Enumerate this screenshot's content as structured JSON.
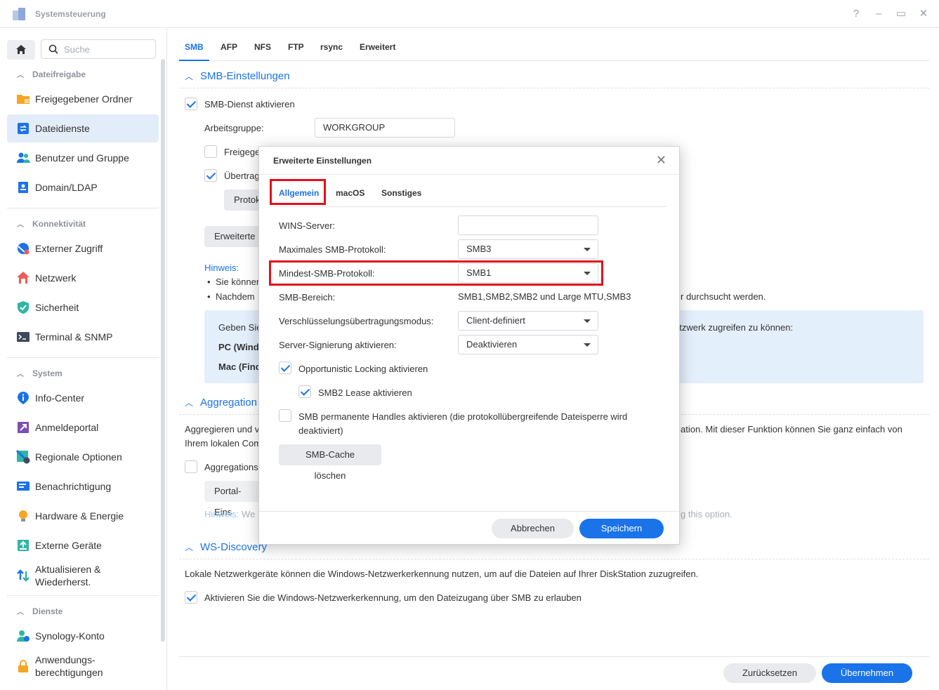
{
  "window": {
    "title": "Systemsteuerung",
    "controls": [
      "?",
      "–",
      "▭",
      "✕"
    ]
  },
  "sidebar": {
    "search_placeholder": "Suche",
    "sections": {
      "dateifreigabe": "Dateifreigabe",
      "konnektivitaet": "Konnektivität",
      "system": "System",
      "dienste": "Dienste"
    },
    "items": {
      "freigegebener_ordner": "Freigegebener Ordner",
      "dateidienste": "Dateidienste",
      "benutzer_gruppe": "Benutzer und Gruppe",
      "domain_ldap": "Domain/LDAP",
      "externer_zugriff": "Externer Zugriff",
      "netzwerk": "Netzwerk",
      "sicherheit": "Sicherheit",
      "terminal_snmp": "Terminal & SNMP",
      "info_center": "Info-Center",
      "anmeldeportal": "Anmeldeportal",
      "regionale_optionen": "Regionale Optionen",
      "benachrichtigung": "Benachrichtigung",
      "hardware_energie": "Hardware & Energie",
      "externe_geraete": "Externe Geräte",
      "aktualisieren_1": "Aktualisieren &",
      "aktualisieren_2": "Wiederherst.",
      "synology_konto": "Synology-Konto",
      "anwendungs_1": "Anwendungs-",
      "anwendungs_2": "berechtigungen"
    }
  },
  "tabs": [
    "SMB",
    "AFP",
    "NFS",
    "FTP",
    "rsync",
    "Erweitert"
  ],
  "smb": {
    "section_title": "SMB-Einstellungen",
    "enable_label": "SMB-Dienst aktivieren",
    "workgroup_label": "Arbeitsgruppe:",
    "workgroup_value": "WORKGROUP",
    "share_label": "Freigege",
    "transfer_label": "Übertrag",
    "protocol_btn": "Protok",
    "advanced_btn": "Erweiterte",
    "hint_label": "Hinweis:",
    "hint_1": "Sie könner",
    "hint_2": "Nachdem",
    "hint_2_tail": "r durchsucht werden.",
    "info_1": "Geben Sie",
    "info_1_tail": "etzwerk zugreifen zu können:",
    "info_pc": "PC (Wind",
    "info_mac": "Mac (Find"
  },
  "aggregation": {
    "section_title": "Aggregation",
    "desc_1": "Aggregieren und v",
    "desc_1_tail": "ation. Mit dieser Funktion können Sie ganz einfach von",
    "desc_2": "Ihrem lokalen Com",
    "checkbox_label": "Aggregations",
    "portal_btn": "Portal-Eins",
    "hint_label": "Hinweis:",
    "hint_text": "We",
    "hint_tail": "g this option."
  },
  "ws": {
    "section_title": "WS-Discovery",
    "desc": "Lokale Netzwerkgeräte können die Windows-Netzwerkerkennung nutzen, um auf die Dateien auf Ihrer DiskStation zuzugreifen.",
    "checkbox_label": "Aktivieren Sie die Windows-Netzwerkerkennung, um den Dateizugang über SMB zu erlauben"
  },
  "footer": {
    "reset": "Zurücksetzen",
    "apply": "Übernehmen"
  },
  "dialog": {
    "title": "Erweiterte Einstellungen",
    "tabs": [
      "Allgemein",
      "macOS",
      "Sonstiges"
    ],
    "wins_label": "WINS-Server:",
    "wins_value": "",
    "max_proto_label": "Maximales SMB-Protokoll:",
    "max_proto_value": "SMB3",
    "min_proto_label": "Mindest-SMB-Protokoll:",
    "min_proto_value": "SMB1",
    "range_label": "SMB-Bereich:",
    "range_value": "SMB1,SMB2,SMB2 und Large MTU,SMB3",
    "encryption_label": "Verschlüsselungsübertragungsmodus:",
    "encryption_value": "Client-definiert",
    "signing_label": "Server-Signierung aktivieren:",
    "signing_value": "Deaktivieren",
    "oplock_label": "Opportunistic Locking aktivieren",
    "lease_label": "SMB2 Lease aktivieren",
    "handles_label_1": "SMB permanente Handles aktivieren (die protokollübergreifende Dateisperre wird",
    "handles_label_2": "deaktiviert)",
    "clear_cache": "SMB-Cache löschen",
    "cancel": "Abbrechen",
    "save": "Speichern"
  },
  "colors": {
    "accent": "#1a73e8",
    "highlight": "#e2101a",
    "active_bg": "#e3edf9",
    "info_bg": "#e4effc"
  }
}
